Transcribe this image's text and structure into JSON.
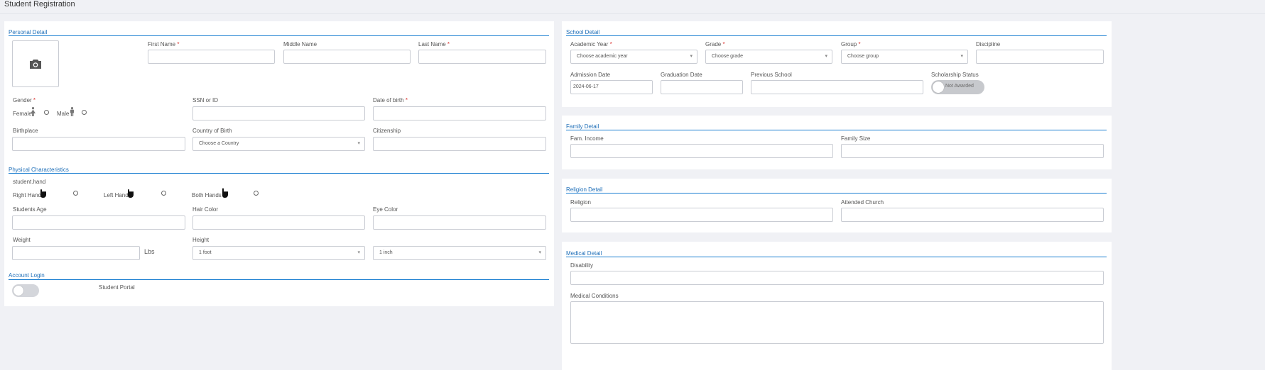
{
  "page": {
    "title": "Student Registration"
  },
  "personal": {
    "section_title": "Personal Detail",
    "first_name_label": "First Name",
    "middle_name_label": "Middle Name",
    "last_name_label": "Last Name",
    "gender_label": "Gender",
    "female_label": "Female",
    "male_label": "Male",
    "ssn_label": "SSN or ID",
    "dob_label": "Date of birth",
    "birthplace_label": "Birthplace",
    "country_label": "Country of Birth",
    "country_value": "Choose a Country",
    "citizenship_label": "Citizenship",
    "required_mark": "*"
  },
  "physical": {
    "section_title": "Physical Characteristics",
    "hand_label": "student.hand",
    "right_hand": "Right Hand",
    "left_hand": "Left Hand",
    "both_hands": "Both Hands",
    "age_label": "Students Age",
    "hair_label": "Hair Color",
    "eye_label": "Eye Color",
    "weight_label": "Weight",
    "weight_unit": "Lbs",
    "height_label": "Height",
    "height_feet_value": "1 foot",
    "height_inches_value": "1 inch"
  },
  "account": {
    "section_title": "Account Login",
    "portal_label": "Student Portal"
  },
  "school": {
    "section_title": "School Detail",
    "academic_year_label": "Academic Year",
    "academic_year_value": "Choose academic year",
    "grade_label": "Grade",
    "grade_value": "Choose grade",
    "group_label": "Group",
    "group_value": "Choose group",
    "discipline_label": "Discipline",
    "admission_label": "Admission Date",
    "admission_value": "2024-06-17",
    "graduation_label": "Graduation Date",
    "previous_school_label": "Previous School",
    "scholarship_label": "Scholarship Status",
    "scholarship_value": "Not Awarded"
  },
  "family": {
    "section_title": "Family Detail",
    "income_label": "Fam. Income",
    "size_label": "Family Size"
  },
  "religion": {
    "section_title": "Religion Detail",
    "religion_label": "Religion",
    "church_label": "Attended Church"
  },
  "medical": {
    "section_title": "Medical Detail",
    "disability_label": "Disability",
    "conditions_label": "Medical Conditions"
  },
  "colors": {
    "accent": "#1a7ed1",
    "required": "#d9302c"
  }
}
